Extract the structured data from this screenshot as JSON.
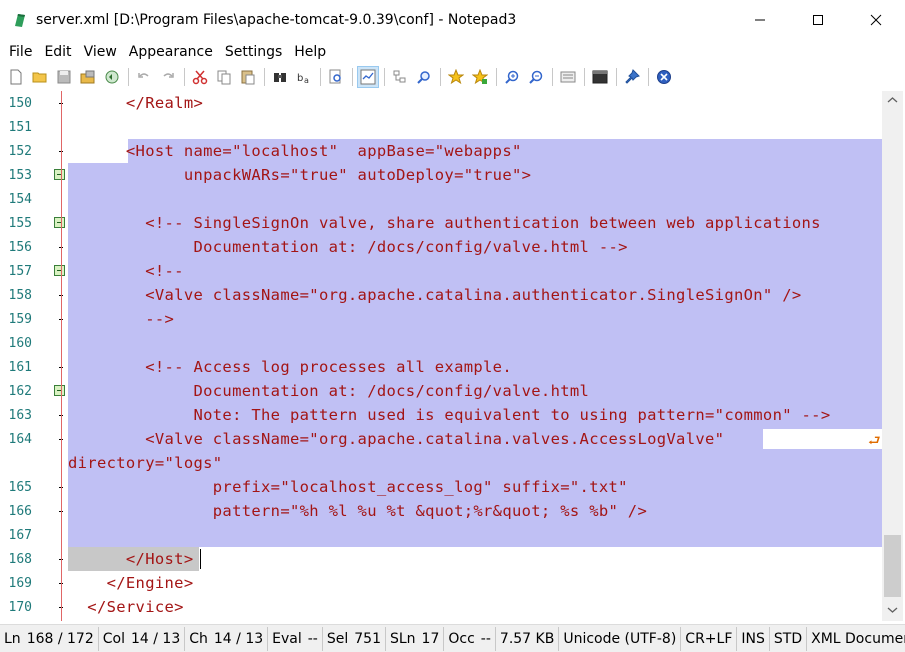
{
  "window": {
    "title": "server.xml [D:\\Program Files\\apache-tomcat-9.0.39\\conf] - Notepad3"
  },
  "menu": {
    "items": [
      "File",
      "Edit",
      "View",
      "Appearance",
      "Settings",
      "Help"
    ]
  },
  "toolbar": {
    "buttons": [
      "new-file-icon",
      "open-folder-icon",
      "save-icon",
      "save-as-icon",
      "revert-icon",
      "undo-icon",
      "redo-icon",
      "cut-icon",
      "copy-icon",
      "paste-icon",
      "find-icon",
      "replace-icon",
      "find-in-files-icon",
      "word-wrap-icon",
      "tree-icon",
      "zoom-find-icon",
      "bookmark-star-icon",
      "add-bookmark-icon",
      "zoom-in-icon",
      "zoom-out-icon",
      "scheme-icon",
      "console-icon",
      "pin-icon",
      "close-doc-icon"
    ]
  },
  "editor": {
    "lines": [
      {
        "num": "150",
        "text": "      </Realm>"
      },
      {
        "num": "151",
        "text": ""
      },
      {
        "num": "152",
        "text": "      <Host name=\"localhost\"  appBase=\"webapps\""
      },
      {
        "num": "153",
        "text": "            unpackWARs=\"true\" autoDeploy=\"true\">"
      },
      {
        "num": "154",
        "text": ""
      },
      {
        "num": "155",
        "text": "        <!-- SingleSignOn valve, share authentication between web applications"
      },
      {
        "num": "156",
        "text": "             Documentation at: /docs/config/valve.html -->"
      },
      {
        "num": "157",
        "text": "        <!--"
      },
      {
        "num": "158",
        "text": "        <Valve className=\"org.apache.catalina.authenticator.SingleSignOn\" />"
      },
      {
        "num": "159",
        "text": "        -->"
      },
      {
        "num": "160",
        "text": ""
      },
      {
        "num": "161",
        "text": "        <!-- Access log processes all example."
      },
      {
        "num": "162",
        "text": "             Documentation at: /docs/config/valve.html"
      },
      {
        "num": "163",
        "text": "             Note: The pattern used is equivalent to using pattern=\"common\" -->"
      },
      {
        "num": "164",
        "text": "        <Valve className=\"org.apache.catalina.valves.AccessLogValve\""
      },
      {
        "num": "",
        "text": "directory=\"logs\""
      },
      {
        "num": "165",
        "text": "               prefix=\"localhost_access_log\" suffix=\".txt\""
      },
      {
        "num": "166",
        "text": "               pattern=\"%h %l %u %t &quot;%r&quot; %s %b\" />"
      },
      {
        "num": "167",
        "text": ""
      },
      {
        "num": "168",
        "text": "      </Host>"
      },
      {
        "num": "169",
        "text": "    </Engine>"
      },
      {
        "num": "170",
        "text": "  </Service>"
      }
    ],
    "wrap_symbol": "⮐"
  },
  "statusbar": {
    "ln_label": "Ln",
    "ln_value": "168 / 172",
    "col_label": "Col",
    "col_value": "14 / 13",
    "ch_label": "Ch",
    "ch_value": "14 / 13",
    "eval_label": "Eval",
    "eval_value": "--",
    "sel_label": "Sel",
    "sel_value": "751",
    "sln_label": "SLn",
    "sln_value": "17",
    "occ_label": "Occ",
    "occ_value": "--",
    "size": "7.57 KB",
    "encoding": "Unicode (UTF-8)",
    "eol": "CR+LF",
    "ins": "INS",
    "std": "STD",
    "lexer": "XML Document"
  },
  "colors": {
    "selection": "#c0c0f4",
    "code_text": "#a31515",
    "line_numbers": "#1f7a7a",
    "fold_marker": "#d9f2c2"
  }
}
